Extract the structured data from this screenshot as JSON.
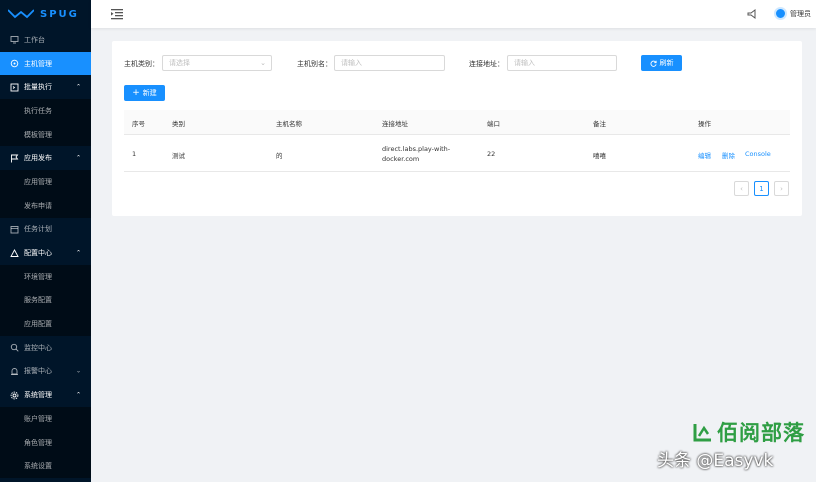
{
  "app": {
    "logo_text": "SPUG"
  },
  "sidebar": {
    "items": [
      {
        "label": "工作台",
        "icon": "desktop-icon",
        "kind": "item"
      },
      {
        "label": "主机管理",
        "icon": "cloud-server-icon",
        "kind": "active"
      },
      {
        "label": "批量执行",
        "icon": "code-icon",
        "kind": "group",
        "caret": "up"
      },
      {
        "label": "执行任务",
        "kind": "sub"
      },
      {
        "label": "模板管理",
        "kind": "sub"
      },
      {
        "label": "应用发布",
        "icon": "flag-icon",
        "kind": "group",
        "caret": "up"
      },
      {
        "label": "应用管理",
        "kind": "sub"
      },
      {
        "label": "发布申请",
        "kind": "sub"
      },
      {
        "label": "任务计划",
        "icon": "schedule-icon",
        "kind": "item"
      },
      {
        "label": "配置中心",
        "icon": "deployment-icon",
        "kind": "group",
        "caret": "up"
      },
      {
        "label": "环境管理",
        "kind": "sub"
      },
      {
        "label": "服务配置",
        "kind": "sub"
      },
      {
        "label": "应用配置",
        "kind": "sub"
      },
      {
        "label": "监控中心",
        "icon": "monitor-icon",
        "kind": "item"
      },
      {
        "label": "报警中心",
        "icon": "alert-icon",
        "kind": "item",
        "caret": "down"
      },
      {
        "label": "系统管理",
        "icon": "setting-icon",
        "kind": "group",
        "caret": "up"
      },
      {
        "label": "账户管理",
        "kind": "sub"
      },
      {
        "label": "角色管理",
        "kind": "sub"
      },
      {
        "label": "系统设置",
        "kind": "sub"
      }
    ]
  },
  "header": {
    "username": "管理员"
  },
  "filters": {
    "category_label": "主机类别：",
    "category_placeholder": "请选择",
    "alias_label": "主机别名：",
    "alias_placeholder": "请输入",
    "address_label": "连接地址：",
    "address_placeholder": "请输入",
    "refresh_label": "刷新"
  },
  "actions": {
    "new_label": "新建"
  },
  "table": {
    "columns": [
      "序号",
      "类别",
      "主机名称",
      "连接地址",
      "端口",
      "备注",
      "操作"
    ],
    "rows": [
      {
        "index": "1",
        "category": "测试",
        "name": "的",
        "address_line1": "direct.labs.play-with-",
        "address_line2": "docker.com",
        "port": "22",
        "note": "嘻嘻",
        "op_edit": "编辑",
        "op_delete": "删除",
        "op_console": "Console"
      }
    ]
  },
  "pagination": {
    "prev": "‹",
    "current": "1",
    "next": "›"
  },
  "watermark": {
    "brand": "佰阅部落",
    "text": "头条 @Easyvk"
  },
  "colors": {
    "sidebar_bg": "#001529",
    "primary": "#1890ff",
    "page_bg": "#f0f2f5",
    "brand_green": "#2f9e44"
  }
}
